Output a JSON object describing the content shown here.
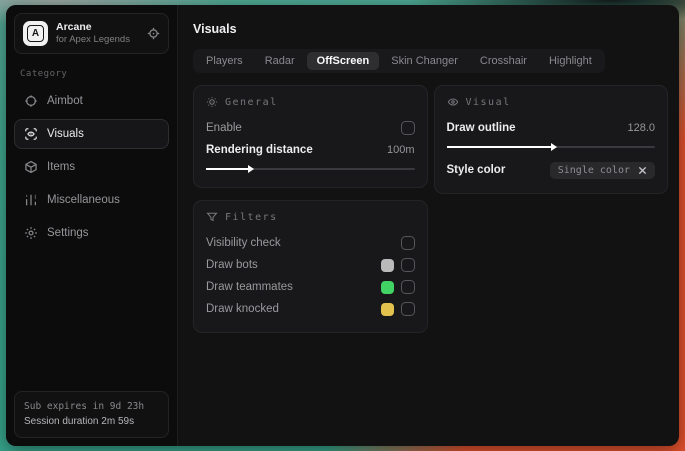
{
  "app": {
    "name": "Arcane",
    "subtitle": "for Apex Legends",
    "logo_letter": "A"
  },
  "sidebar": {
    "category_label": "Category",
    "items": [
      {
        "label": "Aimbot",
        "icon": "crosshair-icon",
        "selected": false
      },
      {
        "label": "Visuals",
        "icon": "scan-eye-icon",
        "selected": true
      },
      {
        "label": "Items",
        "icon": "cube-icon",
        "selected": false
      },
      {
        "label": "Miscellaneous",
        "icon": "bars-icon",
        "selected": false
      },
      {
        "label": "Settings",
        "icon": "gear-icon",
        "selected": false
      }
    ],
    "footer": {
      "sub_expires": "Sub expires in 9d 23h",
      "session_duration": "Session duration 2m 59s"
    }
  },
  "main": {
    "title": "Visuals",
    "tabs": [
      {
        "label": "Players",
        "selected": false
      },
      {
        "label": "Radar",
        "selected": false
      },
      {
        "label": "OffScreen",
        "selected": true
      },
      {
        "label": "Skin Changer",
        "selected": false
      },
      {
        "label": "Crosshair",
        "selected": false
      },
      {
        "label": "Highlight",
        "selected": false
      }
    ],
    "panels": {
      "general": {
        "title": "General",
        "enable_label": "Enable",
        "enable_checked": false,
        "rendering_distance_label": "Rendering distance",
        "rendering_distance_value": "100m",
        "rendering_distance_percent": 20
      },
      "visual": {
        "title": "Visual",
        "draw_outline_label": "Draw outline",
        "draw_outline_value": "128.0",
        "draw_outline_percent": 50,
        "style_color_label": "Style color",
        "style_color_value": "Single color"
      },
      "filters": {
        "title": "Filters",
        "rows": [
          {
            "label": "Visibility check",
            "swatch": null,
            "checked": false
          },
          {
            "label": "Draw bots",
            "swatch": "#bababa",
            "checked": false
          },
          {
            "label": "Draw teammates",
            "swatch": "#41d363",
            "checked": false
          },
          {
            "label": "Draw knocked",
            "swatch": "#e2c14d",
            "checked": false
          }
        ]
      }
    }
  },
  "colors": {
    "accent_green": "#41d363",
    "accent_yellow": "#e2c14d",
    "swatch_gray": "#bababa",
    "desktop_teal": "#3ea78e",
    "desktop_orange": "#e1512d",
    "window_bg": "#121213",
    "panel_bg": "#18181a"
  }
}
